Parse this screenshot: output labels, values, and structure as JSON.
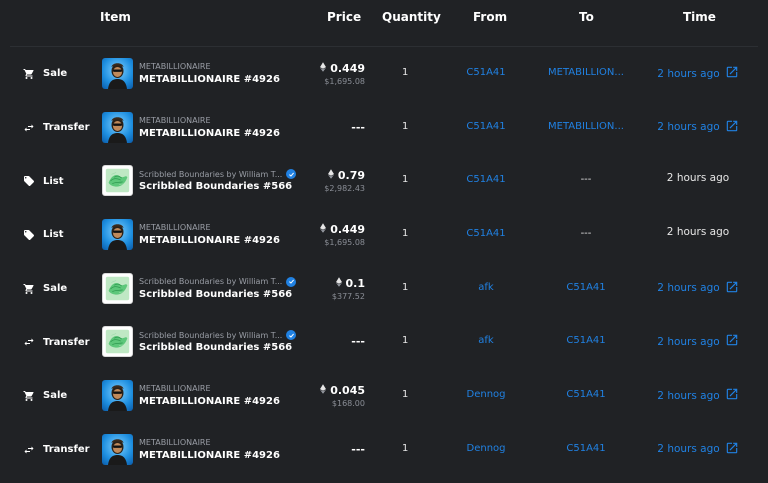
{
  "header": {
    "item": "Item",
    "price": "Price",
    "quantity": "Quantity",
    "from": "From",
    "to": "To",
    "time": "Time"
  },
  "rows": [
    {
      "event": "Sale",
      "event_icon": "cart-icon",
      "thumb": "metabillionaire",
      "collection": "METABILLIONAIRE",
      "verified": false,
      "name": "METABILLIONAIRE #4926",
      "price_eth": "0.449",
      "price_usd": "$1,695.08",
      "quantity": "1",
      "from": "C51A41",
      "to": "METABILLION...",
      "time": "2 hours ago",
      "time_link": true
    },
    {
      "event": "Transfer",
      "event_icon": "transfer-icon",
      "thumb": "metabillionaire",
      "collection": "METABILLIONAIRE",
      "verified": false,
      "name": "METABILLIONAIRE #4926",
      "price_dash": "---",
      "quantity": "1",
      "from": "C51A41",
      "to": "METABILLION...",
      "time": "2 hours ago",
      "time_link": true
    },
    {
      "event": "List",
      "event_icon": "tag-icon",
      "thumb": "scribbled",
      "collection": "Scribbled Boundaries by William T...",
      "verified": true,
      "name": "Scribbled Boundaries #566",
      "price_eth": "0.79",
      "price_usd": "$2,982.43",
      "quantity": "1",
      "from": "C51A41",
      "to": "---",
      "time": "2 hours ago",
      "time_link": false
    },
    {
      "event": "List",
      "event_icon": "tag-icon",
      "thumb": "metabillionaire",
      "collection": "METABILLIONAIRE",
      "verified": false,
      "name": "METABILLIONAIRE #4926",
      "price_eth": "0.449",
      "price_usd": "$1,695.08",
      "quantity": "1",
      "from": "C51A41",
      "to": "---",
      "time": "2 hours ago",
      "time_link": false
    },
    {
      "event": "Sale",
      "event_icon": "cart-icon",
      "thumb": "scribbled",
      "collection": "Scribbled Boundaries by William T...",
      "verified": true,
      "name": "Scribbled Boundaries #566",
      "price_eth": "0.1",
      "price_usd": "$377.52",
      "quantity": "1",
      "from": "afk",
      "to": "C51A41",
      "time": "2 hours ago",
      "time_link": true
    },
    {
      "event": "Transfer",
      "event_icon": "transfer-icon",
      "thumb": "scribbled",
      "collection": "Scribbled Boundaries by William T...",
      "verified": true,
      "name": "Scribbled Boundaries #566",
      "price_dash": "---",
      "quantity": "1",
      "from": "afk",
      "to": "C51A41",
      "time": "2 hours ago",
      "time_link": true
    },
    {
      "event": "Sale",
      "event_icon": "cart-icon",
      "thumb": "metabillionaire",
      "collection": "METABILLIONAIRE",
      "verified": false,
      "name": "METABILLIONAIRE #4926",
      "price_eth": "0.045",
      "price_usd": "$168.00",
      "quantity": "1",
      "from": "Dennog",
      "to": "C51A41",
      "time": "2 hours ago",
      "time_link": true
    },
    {
      "event": "Transfer",
      "event_icon": "transfer-icon",
      "thumb": "metabillionaire",
      "collection": "METABILLIONAIRE",
      "verified": false,
      "name": "METABILLIONAIRE #4926",
      "price_dash": "---",
      "quantity": "1",
      "from": "Dennog",
      "to": "C51A41",
      "time": "2 hours ago",
      "time_link": true
    }
  ],
  "colors": {
    "background": "#202225",
    "link": "#2081e2",
    "muted": "#9a9ea6",
    "verified": "#2081e2"
  }
}
